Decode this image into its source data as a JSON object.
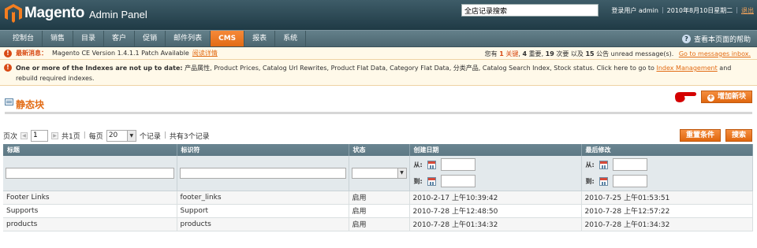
{
  "header": {
    "logo_brand": "Magento",
    "logo_sub": "Admin Panel",
    "search_value": "全店记录搜索",
    "user_label": "登录用户 admin",
    "date": "2010年8月10日星期二",
    "logout": "退出"
  },
  "nav": {
    "items": [
      "控制台",
      "销售",
      "目录",
      "客户",
      "促销",
      "邮件列表",
      "CMS",
      "报表",
      "系统"
    ],
    "active": "CMS",
    "help": "查看本页面的帮助"
  },
  "notice": {
    "latest_label": "最新消息：",
    "latest_text": "Magento CE Version 1.4.1.1 Patch Available",
    "latest_link": "阅读详情",
    "summary_prefix": "您有",
    "critical_count": "1",
    "critical_label": "关键",
    "major_count": "4",
    "major_label": "重要",
    "minor_count": "19",
    "minor_label": "次要 以及",
    "notice_count": "15",
    "notice_label": "公告 unread message(s).",
    "messages_link": "Go to messages inbox."
  },
  "index_notice": {
    "bold": "One or more of the Indexes are not up to date:",
    "text": "产品属性, Product Prices, Catalog Url Rewrites, Product Flat Data, Category Flat Data, 分类产品, Catalog Search Index, Stock status. Click here to go to",
    "link": "Index Management",
    "suffix": "and rebuild required indexes."
  },
  "page": {
    "title": "静态块",
    "add_button": "增加新块"
  },
  "pager": {
    "page_label": "页次",
    "page_value": "1",
    "total_pages": "共1页",
    "per_page_label": "每页",
    "per_page_value": "20",
    "records_label": "个记录",
    "total_records": "共有3个记录",
    "reset_button": "重置条件",
    "search_button": "搜索"
  },
  "grid": {
    "columns": [
      "标题",
      "标识符",
      "状态",
      "创建日期",
      "最后修改"
    ],
    "from_label": "从:",
    "to_label": "到:",
    "rows": [
      [
        "Footer Links",
        "footer_links",
        "启用",
        "2010-2-17 上午10:39:42",
        "2010-7-25 上午01:53:51"
      ],
      [
        "Supports",
        "Support",
        "启用",
        "2010-7-28 上午12:48:50",
        "2010-7-28 上午12:57:22"
      ],
      [
        "products",
        "products",
        "启用",
        "2010-7-28 上午01:34:32",
        "2010-7-28 上午01:34:32"
      ]
    ]
  },
  "colors": {
    "accent": "#e26b14",
    "header_bg": "#2a4753",
    "nav_bg": "#587480",
    "grid_header_bg": "#64808b"
  }
}
